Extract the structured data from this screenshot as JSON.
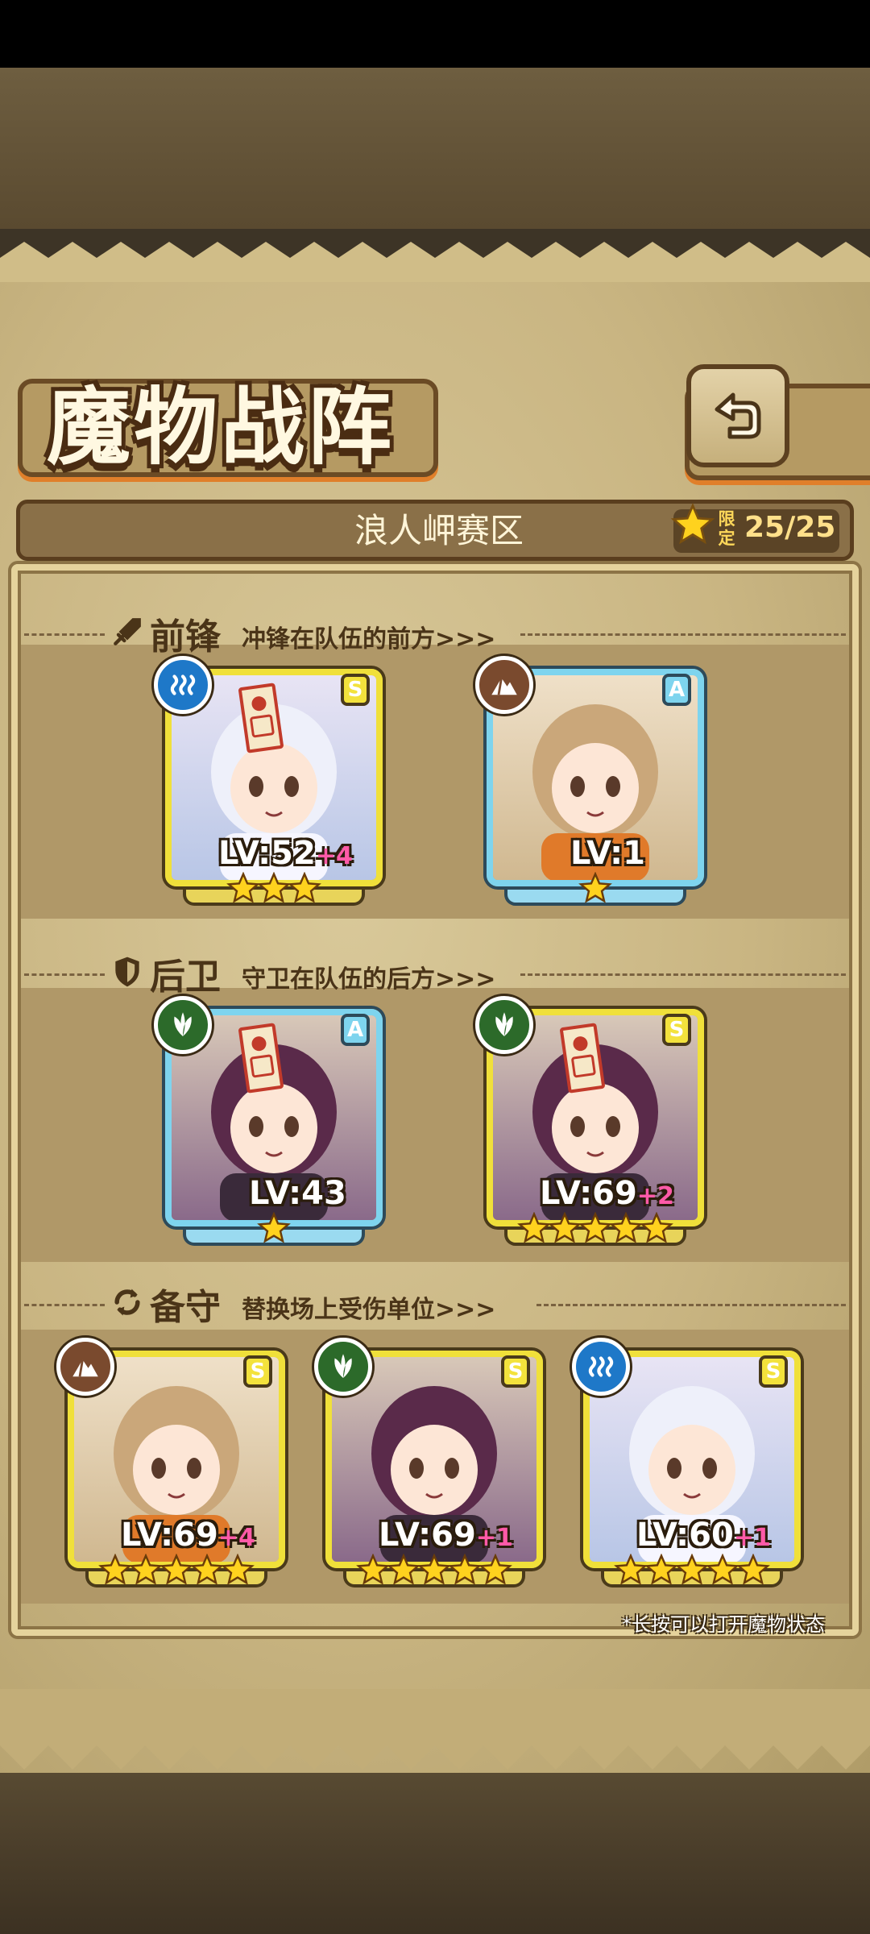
{
  "screen": {
    "title": "魔物战阵",
    "region": "浪人岬赛区",
    "limit_label": "限定",
    "limit_value": "25/25",
    "footnote": "*长按可以打开魔物状态"
  },
  "sections": [
    {
      "title": "前锋",
      "subtitle": "冲锋在队伍的前方>>>",
      "icon": "sword-icon",
      "units": [
        {
          "element": "water",
          "rank": "S",
          "level": "LV:52",
          "bonus": "+4",
          "stars": 3,
          "sealed": true
        },
        {
          "element": "earth",
          "rank": "A",
          "level": "LV:1",
          "bonus": "",
          "stars": 1,
          "sealed": false
        }
      ]
    },
    {
      "title": "后卫",
      "subtitle": "守卫在队伍的后方>>>",
      "icon": "shield-icon",
      "units": [
        {
          "element": "grass",
          "rank": "A",
          "level": "LV:43",
          "bonus": "",
          "stars": 1,
          "sealed": true
        },
        {
          "element": "grass",
          "rank": "S",
          "level": "LV:69",
          "bonus": "+2",
          "stars": 5,
          "sealed": true
        }
      ]
    },
    {
      "title": "备守",
      "subtitle": "替换场上受伤单位>>>",
      "icon": "swap-icon",
      "units": [
        {
          "element": "earth",
          "rank": "S",
          "level": "LV:69",
          "bonus": "+4",
          "stars": 5,
          "sealed": false
        },
        {
          "element": "grass",
          "rank": "S",
          "level": "LV:69",
          "bonus": "+1",
          "stars": 5,
          "sealed": false
        },
        {
          "element": "water",
          "rank": "S",
          "level": "LV:60",
          "bonus": "+1",
          "stars": 5,
          "sealed": false
        }
      ]
    }
  ],
  "colors": {
    "s_frame": "#f0e03a",
    "a_frame": "#7ed4ee",
    "water": "#1e78c8",
    "earth": "#7a4a2e",
    "grass": "#2c6a2a",
    "bonus": "#ff5aa8"
  }
}
